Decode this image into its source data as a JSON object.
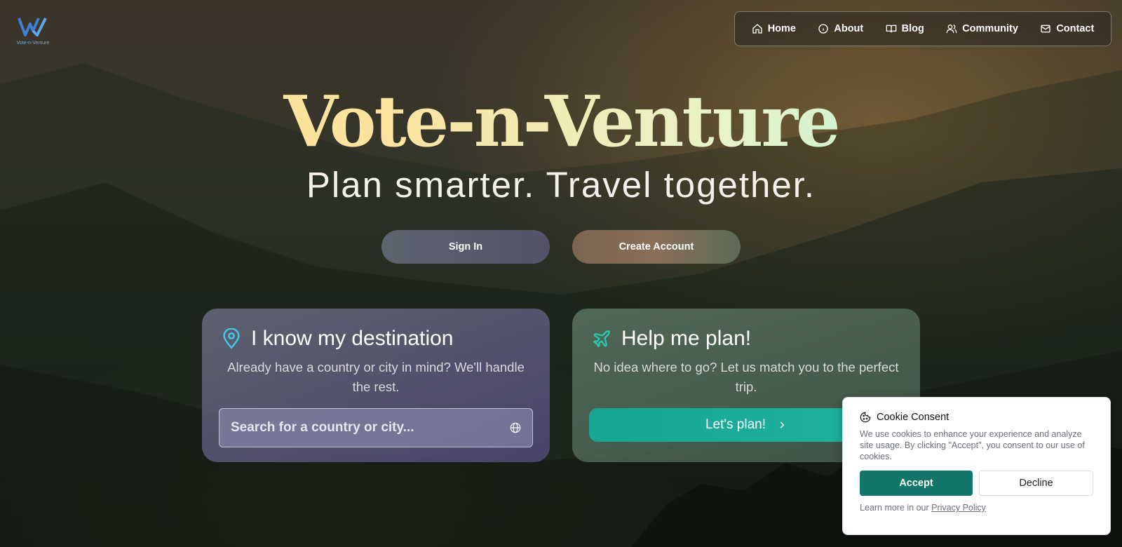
{
  "logo": {
    "text": "Vote-n-Venture"
  },
  "nav": {
    "items": [
      {
        "label": "Home",
        "icon": "home-icon"
      },
      {
        "label": "About",
        "icon": "info-icon"
      },
      {
        "label": "Blog",
        "icon": "book-icon"
      },
      {
        "label": "Community",
        "icon": "users-icon"
      },
      {
        "label": "Contact",
        "icon": "mail-icon"
      }
    ]
  },
  "hero": {
    "title": "Vote-n-Venture",
    "tagline": "Plan smarter. Travel together.",
    "sign_in": "Sign In",
    "create_account": "Create Account"
  },
  "destination_card": {
    "title": "I know my destination",
    "description": "Already have a country or city in mind? We'll handle the rest.",
    "search_placeholder": "Search for a country or city...",
    "icon": "map-pin-icon"
  },
  "plan_card": {
    "title": "Help me plan!",
    "description": "No idea where to go? Let us match you to the perfect trip.",
    "button": "Let's plan!",
    "icon": "plane-icon"
  },
  "cookie": {
    "title": "Cookie Consent",
    "text": "We use cookies to enhance your experience and analyze site usage. By clicking \"Accept\", you consent to our use of cookies.",
    "accept": "Accept",
    "decline": "Decline",
    "footer_prefix": "Learn more in our ",
    "privacy_link": "Privacy Policy"
  },
  "colors": {
    "accent_teal": "#12766b",
    "plan_button": "#1fb39f",
    "title_gold": "#ffe18e",
    "title_mint": "#9ff0dc"
  }
}
